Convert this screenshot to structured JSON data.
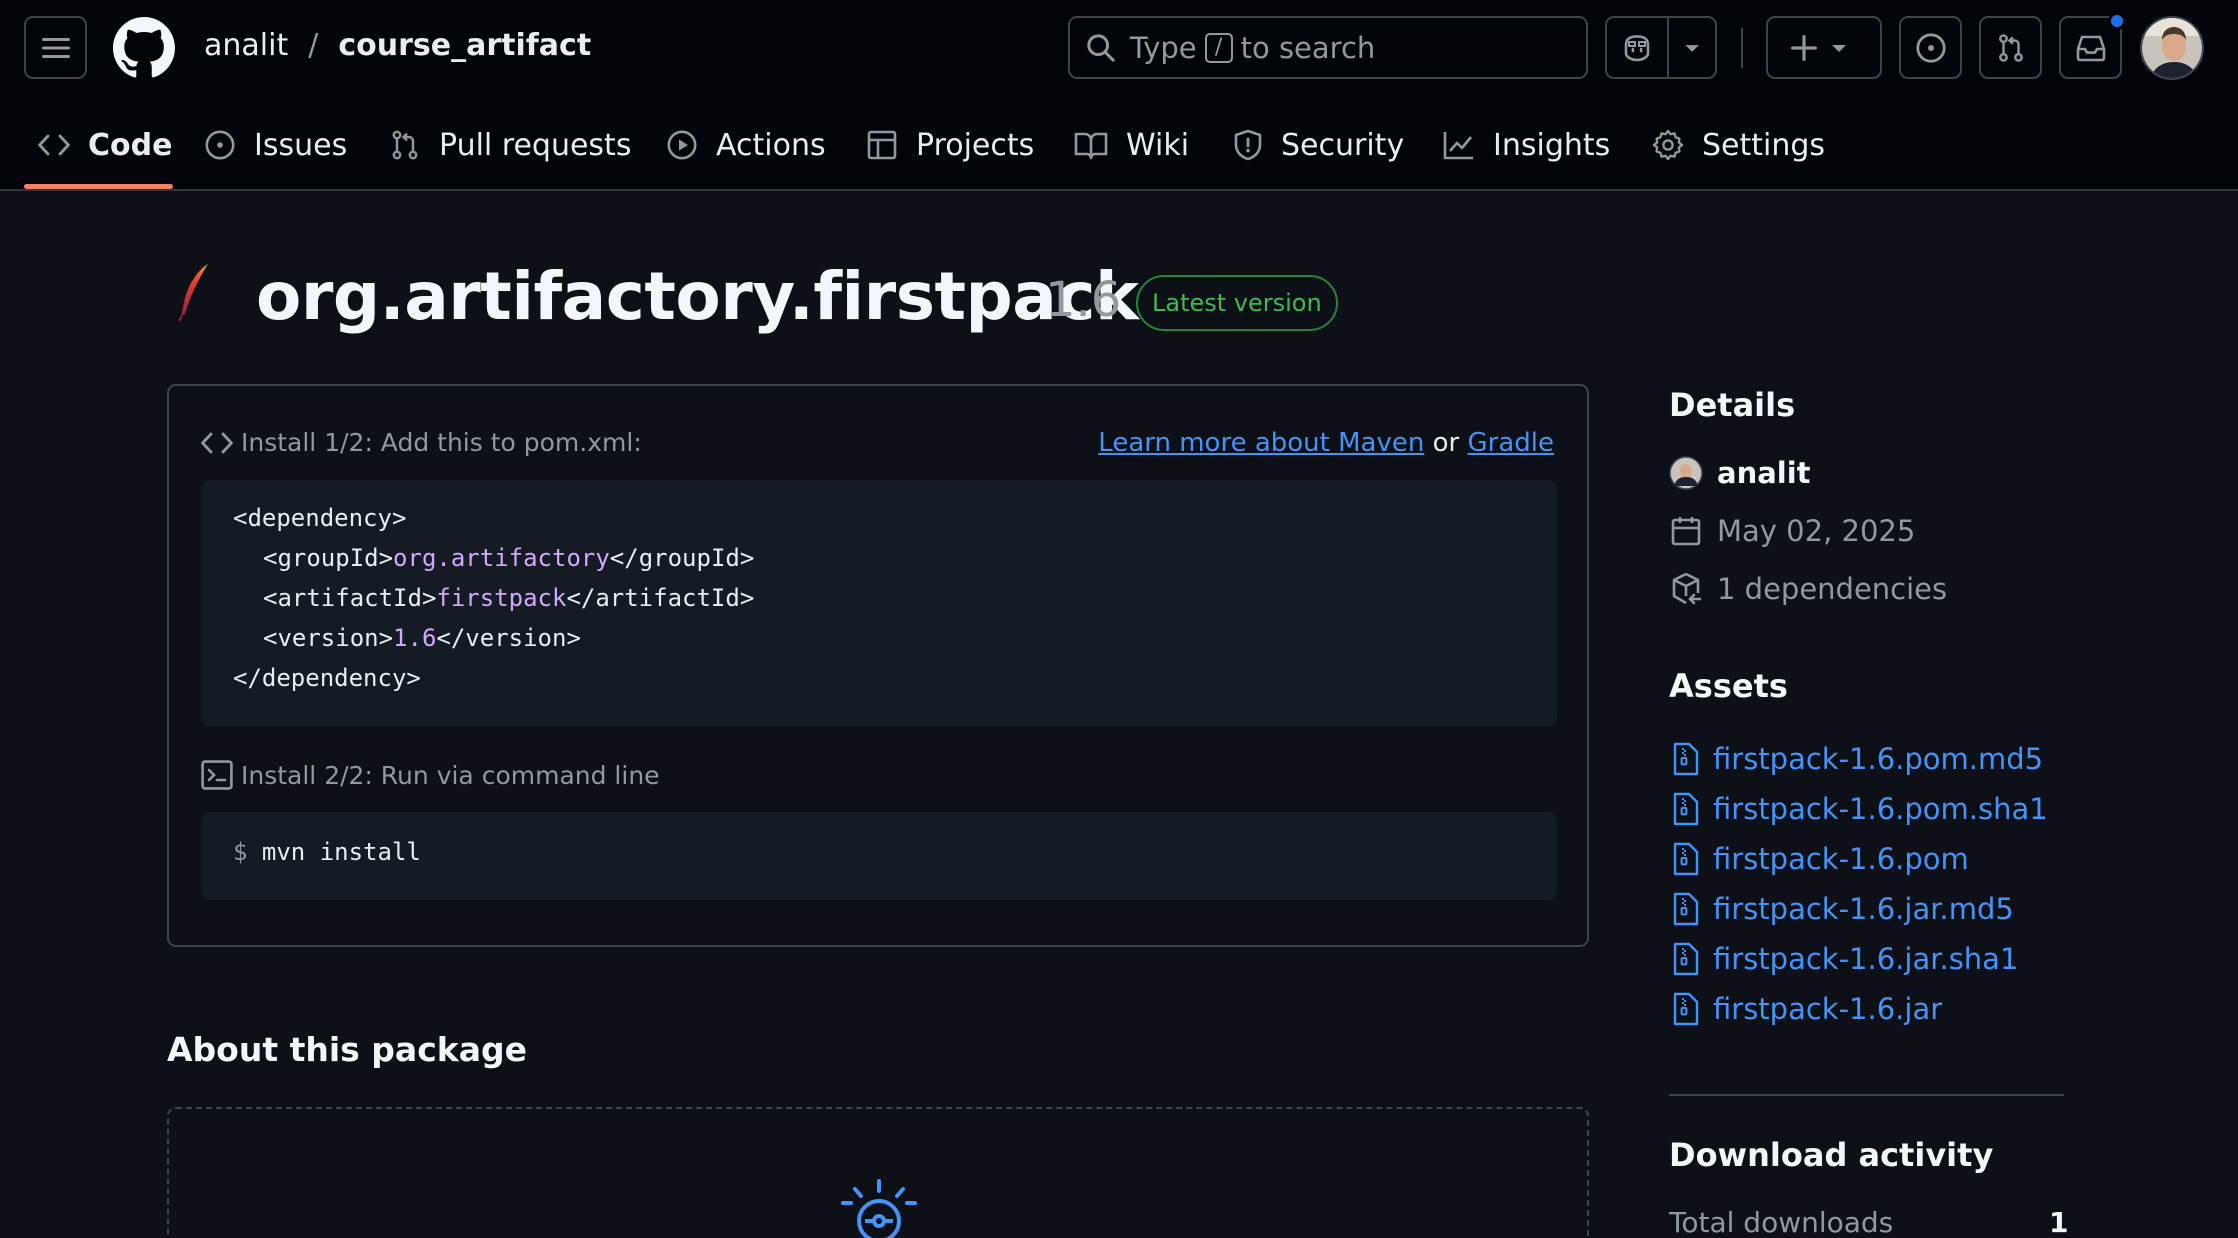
{
  "header": {
    "owner": "analit",
    "separator": "/",
    "repo": "course_artifact",
    "search": {
      "prefix": "Type",
      "key": "/",
      "suffix": "to search"
    }
  },
  "tabs": [
    {
      "label": "Code",
      "icon": "code-icon",
      "active": true
    },
    {
      "label": "Issues",
      "icon": "issue-icon"
    },
    {
      "label": "Pull requests",
      "icon": "pull-request-icon"
    },
    {
      "label": "Actions",
      "icon": "play-icon"
    },
    {
      "label": "Projects",
      "icon": "table-icon"
    },
    {
      "label": "Wiki",
      "icon": "book-icon"
    },
    {
      "label": "Security",
      "icon": "shield-icon"
    },
    {
      "label": "Insights",
      "icon": "graph-icon"
    },
    {
      "label": "Settings",
      "icon": "gear-icon"
    }
  ],
  "package": {
    "name": "org.artifactory.firstpack",
    "version": "1.6",
    "badge": "Latest version"
  },
  "install": {
    "step1_label": "Install 1/2: Add this to pom.xml:",
    "learn_prefix": "Learn more about Maven",
    "learn_or": "or",
    "learn_gradle": "Gradle",
    "pom": {
      "open_dep": "<dependency>",
      "group_open": "<groupId>",
      "group_value": "org.artifactory",
      "group_close": "</groupId>",
      "artifact_open": "<artifactId>",
      "artifact_value": "firstpack",
      "artifact_close": "</artifactId>",
      "version_open": "<version>",
      "version_value": "1.6",
      "version_close": "</version>",
      "close_dep": "</dependency>"
    },
    "step2_label": "Install 2/2: Run via command line",
    "cmd_prompt": "$",
    "cmd": "mvn install"
  },
  "about": {
    "heading": "About this package"
  },
  "sidebar": {
    "details_heading": "Details",
    "user": "analit",
    "date": "May 02, 2025",
    "dependencies": "1 dependencies",
    "assets_heading": "Assets",
    "assets": [
      "firstpack-1.6.pom.md5",
      "firstpack-1.6.pom.sha1",
      "firstpack-1.6.pom",
      "firstpack-1.6.jar.md5",
      "firstpack-1.6.jar.sha1",
      "firstpack-1.6.jar"
    ],
    "download_heading": "Download activity",
    "total_downloads_label": "Total downloads",
    "total_downloads_value": "1"
  },
  "colors": {
    "background": "#0d1117",
    "header_bg": "#010409",
    "accent_link": "#4493f8",
    "active_tab_underline": "#f78166",
    "badge_green": "#3fb950",
    "code_value": "#d2a8ff"
  }
}
